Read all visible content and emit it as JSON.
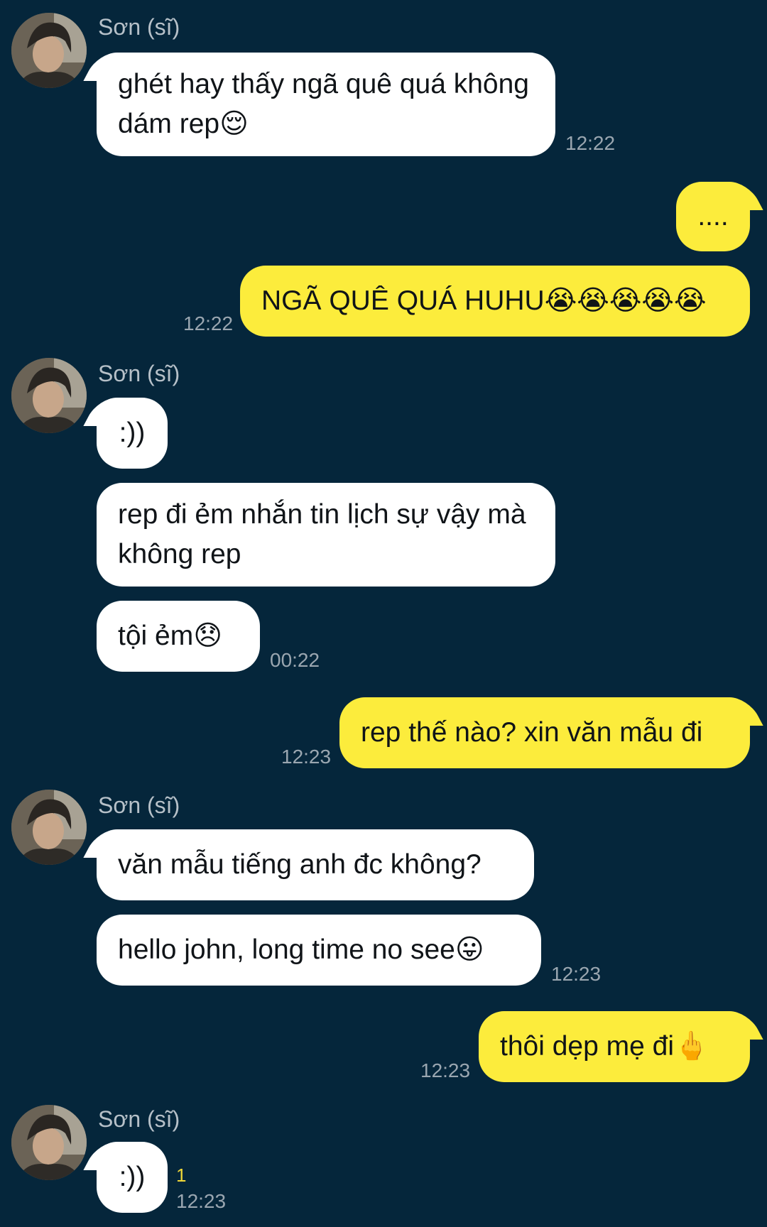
{
  "contact": {
    "name": "Sơn (sĩ)",
    "avatar_icon": "profile-photo"
  },
  "messages": [
    {
      "id": "m1",
      "side": "received",
      "text": "ghét hay thấy ngã quê quá không dám rep😌",
      "time": "12:22"
    },
    {
      "id": "m2",
      "side": "sent",
      "text": "...."
    },
    {
      "id": "m3",
      "side": "sent",
      "text": "NGÃ QUÊ QUÁ HUHU😭😭😭😭😭",
      "time": "12:22"
    },
    {
      "id": "m4",
      "side": "received",
      "text": ":))"
    },
    {
      "id": "m5",
      "side": "received",
      "text": "rep đi ẻm nhắn tin lịch sự vậy mà không rep"
    },
    {
      "id": "m6",
      "side": "received",
      "text": "tội ẻm😞",
      "time": "00:22"
    },
    {
      "id": "m7",
      "side": "sent",
      "text": "rep thế nào? xin văn mẫu đi",
      "time": "12:23"
    },
    {
      "id": "m8",
      "side": "received",
      "text": "văn mẫu tiếng anh đc không?"
    },
    {
      "id": "m9",
      "side": "received",
      "text": "hello john, long time no see😛",
      "time": "12:23"
    },
    {
      "id": "m10",
      "side": "sent",
      "text": "thôi dẹp mẹ đi🖕",
      "time": "12:23"
    },
    {
      "id": "m11",
      "side": "received",
      "text": ":))",
      "time": "12:23",
      "unread_count": "1"
    }
  ],
  "colors": {
    "background": "#05263b",
    "received_bubble": "#ffffff",
    "sent_bubble": "#fcec3c",
    "timestamp": "#9aa6b0",
    "unread": "#f1d838"
  }
}
